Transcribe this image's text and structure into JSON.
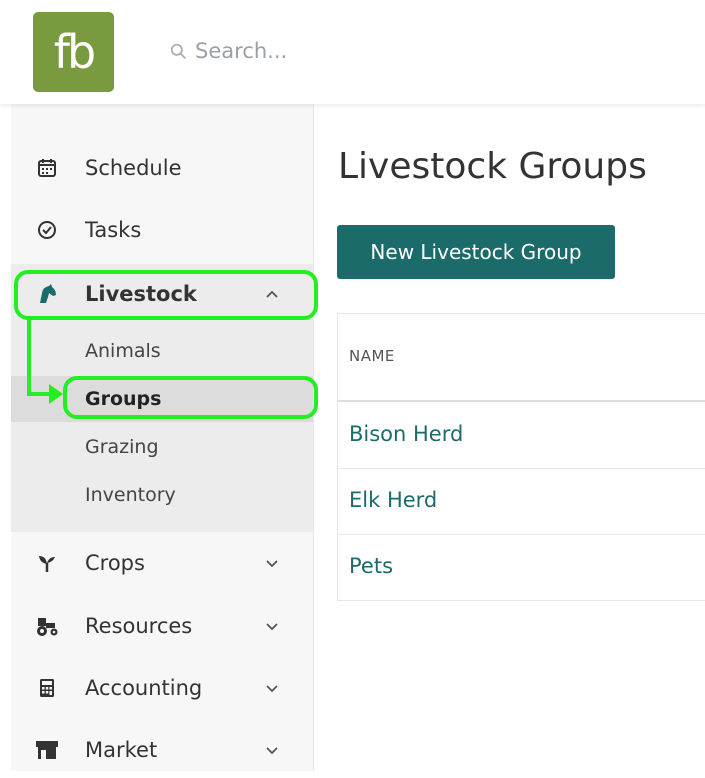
{
  "logo": {
    "text": "fb"
  },
  "search": {
    "placeholder": "Search..."
  },
  "sidebar": {
    "items": [
      {
        "label": "Schedule"
      },
      {
        "label": "Tasks"
      },
      {
        "label": "Livestock"
      },
      {
        "label": "Crops"
      },
      {
        "label": "Resources"
      },
      {
        "label": "Accounting"
      },
      {
        "label": "Market"
      }
    ],
    "livestock_sub": [
      {
        "label": "Animals"
      },
      {
        "label": "Groups"
      },
      {
        "label": "Grazing"
      },
      {
        "label": "Inventory"
      }
    ]
  },
  "main": {
    "title": "Livestock Groups",
    "new_button": "New Livestock Group",
    "table": {
      "header": "NAME",
      "rows": [
        {
          "name": "Bison Herd"
        },
        {
          "name": "Elk Herd"
        },
        {
          "name": "Pets"
        }
      ]
    }
  },
  "colors": {
    "brand": "#7a9a3f",
    "accent": "#1c6b6b",
    "highlight": "#22ee22"
  }
}
